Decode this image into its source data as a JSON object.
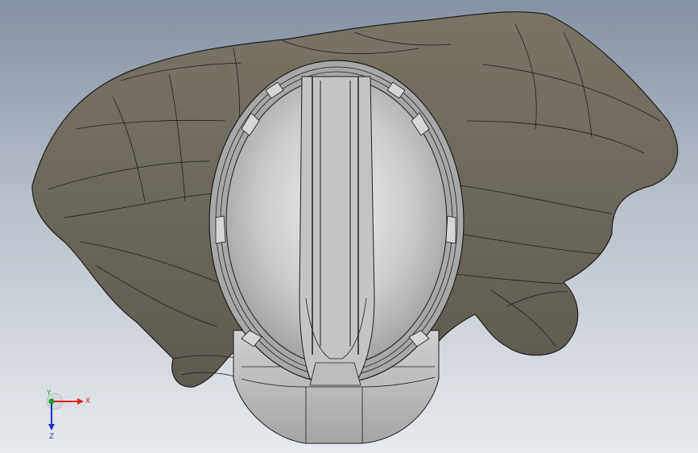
{
  "triad": {
    "x_label": "X",
    "y_label": "Y",
    "z_label": "Z",
    "x_color": "#e02020",
    "y_color": "#20a020",
    "z_color": "#2030c0"
  },
  "model": {
    "body_color": "#6b665a",
    "body_highlight": "#8a8474",
    "edge_color": "#1e1e1e",
    "helmet_color": "#b9b9b9",
    "helmet_highlight": "#e6e6e6"
  }
}
